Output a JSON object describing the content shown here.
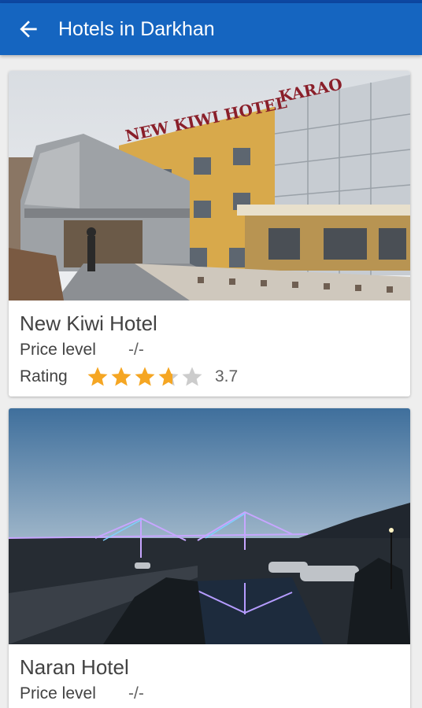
{
  "app": {
    "title": "Hotels in Darkhan",
    "back_icon": "arrow-left-icon",
    "colors": {
      "appbar": "#1565c0",
      "statusbar": "#0d47a1",
      "star": "#f5a623",
      "star_empty": "#cccccc"
    }
  },
  "hotels": [
    {
      "name": "New Kiwi Hotel",
      "price_label": "Price level",
      "price_value": "-/-",
      "rating_label": "Rating",
      "rating": 3.7,
      "rating_text": "3.7",
      "photo_sign": "NEW KIWI HOTEL",
      "photo_sign_2": "KARAO"
    },
    {
      "name": "Naran Hotel",
      "price_label": "Price level",
      "price_value": "-/-"
    }
  ]
}
